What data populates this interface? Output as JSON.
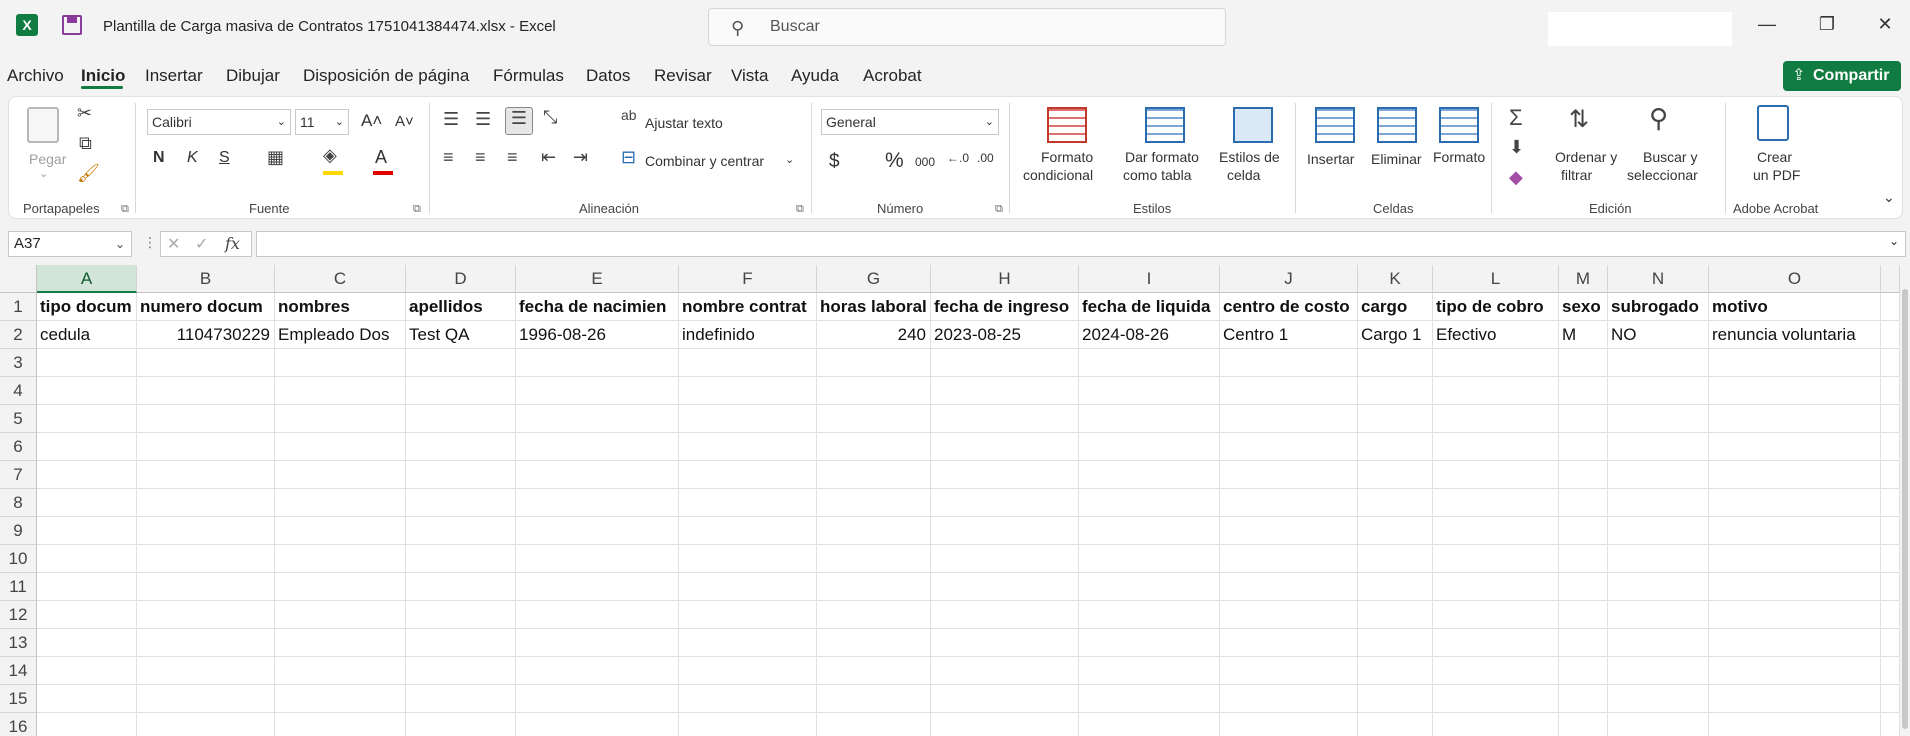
{
  "titlebar": {
    "title": "Plantilla de Carga masiva de Contratos 1751041384474.xlsx  -  Excel",
    "search_placeholder": "Buscar",
    "app_logo": "X",
    "minimize": "—",
    "restore": "❐",
    "close": "✕"
  },
  "menu": {
    "items": [
      "Archivo",
      "Inicio",
      "Insertar",
      "Dibujar",
      "Disposición de página",
      "Fórmulas",
      "Datos",
      "Revisar",
      "Vista",
      "Ayuda",
      "Acrobat"
    ],
    "share": "Compartir"
  },
  "ribbon": {
    "groups": {
      "portapapeles": "Portapapeles",
      "fuente": "Fuente",
      "alineacion": "Alineación",
      "numero": "Número",
      "estilos": "Estilos",
      "celdas": "Celdas",
      "edicion": "Edición",
      "adobe": "Adobe Acrobat"
    },
    "pegar": "Pegar",
    "font_name": "Calibri",
    "font_size": "11",
    "bold": "N",
    "italic": "K",
    "underline": "S",
    "ajustar_texto": "Ajustar texto",
    "combinar": "Combinar y centrar",
    "number_format": "General",
    "formato_condicional": [
      "Formato",
      "condicional"
    ],
    "dar_formato": [
      "Dar formato",
      "como tabla"
    ],
    "estilos_celda": [
      "Estilos de",
      "celda"
    ],
    "insertar": "Insertar",
    "eliminar": "Eliminar",
    "formato": "Formato",
    "ordenar": [
      "Ordenar y",
      "filtrar"
    ],
    "buscar": [
      "Buscar y",
      "seleccionar"
    ],
    "crear_pdf": [
      "Crear",
      "un PDF"
    ]
  },
  "formula_bar": {
    "name_box": "A37",
    "fx": "fx",
    "value": ""
  },
  "sheet": {
    "columns": [
      "A",
      "B",
      "C",
      "D",
      "E",
      "F",
      "G",
      "H",
      "I",
      "J",
      "K",
      "L",
      "M",
      "N",
      "O"
    ],
    "selected_column": "A",
    "rows": [
      "1",
      "2",
      "3",
      "4",
      "5",
      "6",
      "7",
      "8",
      "9",
      "10",
      "11",
      "12",
      "13",
      "14",
      "15",
      "16"
    ],
    "header_row": [
      "tipo docum",
      "numero docum",
      "nombres",
      "apellidos",
      "fecha de nacimien",
      "nombre contrat",
      "horas laboral",
      "fecha de ingreso",
      "fecha de liquida",
      "centro de costo",
      "cargo",
      "tipo de cobro",
      "sexo",
      "subrogado",
      "motivo"
    ],
    "data_row": [
      "cedula",
      "1104730229",
      "Empleado Dos",
      "Test QA",
      "1996-08-26",
      "indefinido",
      "240",
      "2023-08-25",
      "2024-08-26",
      "Centro 1",
      "Cargo 1",
      "Efectivo",
      "M",
      "NO",
      "renuncia voluntaria"
    ]
  },
  "colors": {
    "accent": "#107c41",
    "selected_header": "#d3e4d9"
  }
}
